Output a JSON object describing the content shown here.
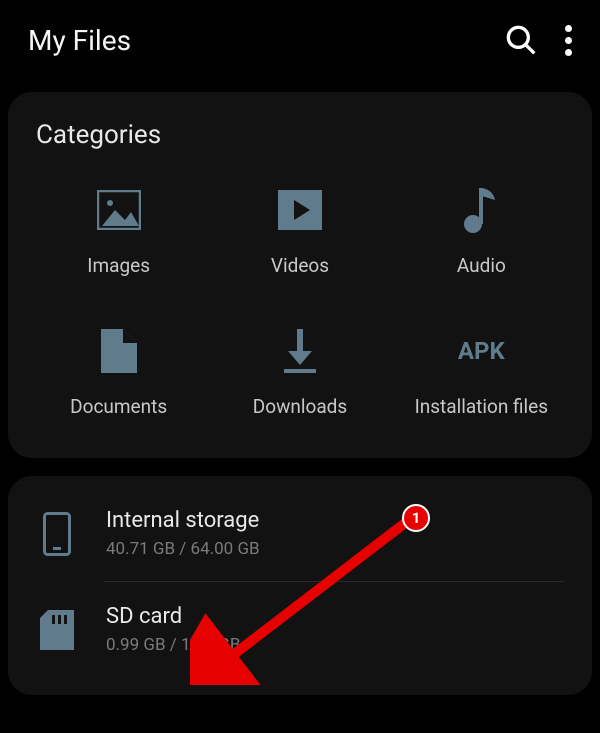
{
  "header": {
    "title": "My Files"
  },
  "categories": {
    "title": "Categories",
    "items": [
      {
        "label": "Images"
      },
      {
        "label": "Videos"
      },
      {
        "label": "Audio"
      },
      {
        "label": "Documents"
      },
      {
        "label": "Downloads"
      },
      {
        "label": "Installation files",
        "apk_text": "APK"
      }
    ]
  },
  "storage": {
    "internal": {
      "name": "Internal storage",
      "size": "40.71 GB / 64.00 GB"
    },
    "sdcard": {
      "name": "SD card",
      "size": "0.99 GB / 1.86 GB"
    }
  },
  "annotation": {
    "badge": "1"
  }
}
